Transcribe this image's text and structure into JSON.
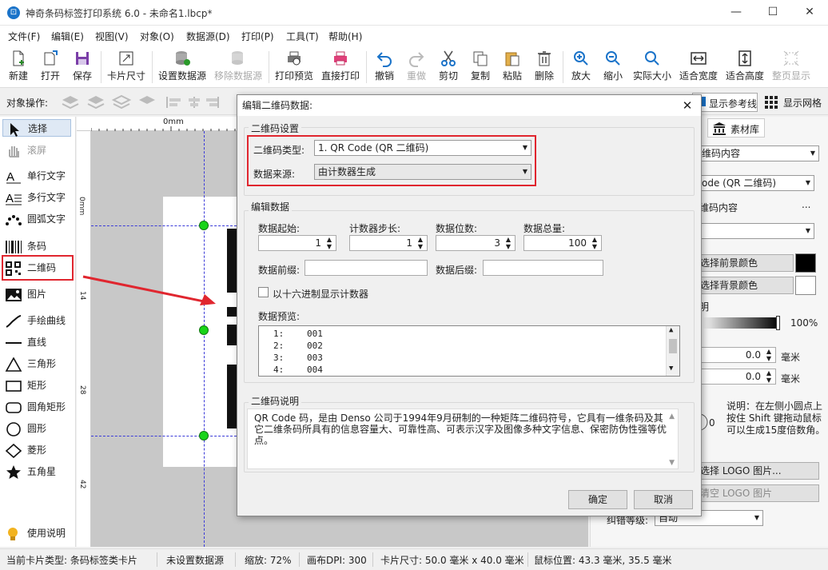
{
  "window": {
    "title": "神奇条码标签打印系统 6.0 - 未命名1.lbcp*",
    "app_icon": "⊡",
    "minimize": "—",
    "maximize": "☐",
    "close": "✕"
  },
  "menu": [
    "文件(F)",
    "编辑(E)",
    "视图(V)",
    "对象(O)",
    "数据源(D)",
    "打印(P)",
    "工具(T)",
    "帮助(H)"
  ],
  "toolbar": [
    {
      "label": "新建",
      "icon": "new-file-icon"
    },
    {
      "label": "打开",
      "icon": "open-icon"
    },
    {
      "label": "保存",
      "icon": "save-icon"
    },
    {
      "label": "卡片尺寸",
      "icon": "card-size-icon"
    },
    {
      "label": "设置数据源",
      "icon": "database-icon"
    },
    {
      "label": "移除数据源",
      "icon": "remove-database-icon"
    },
    {
      "label": "打印预览",
      "icon": "print-preview-icon"
    },
    {
      "label": "直接打印",
      "icon": "print-icon"
    },
    {
      "label": "撤销",
      "icon": "undo-icon"
    },
    {
      "label": "重做",
      "icon": "redo-icon"
    },
    {
      "label": "剪切",
      "icon": "cut-icon"
    },
    {
      "label": "复制",
      "icon": "copy-icon"
    },
    {
      "label": "粘贴",
      "icon": "paste-icon"
    },
    {
      "label": "删除",
      "icon": "delete-icon"
    },
    {
      "label": "放大",
      "icon": "zoom-in-icon"
    },
    {
      "label": "缩小",
      "icon": "zoom-out-icon"
    },
    {
      "label": "实际大小",
      "icon": "actual-size-icon"
    },
    {
      "label": "适合宽度",
      "icon": "fit-width-icon"
    },
    {
      "label": "适合高度",
      "icon": "fit-height-icon"
    },
    {
      "label": "整页显示",
      "icon": "full-page-icon"
    }
  ],
  "objbar": {
    "label": "对象操作:",
    "show_guides": "显示参考线",
    "show_grid": "显示网格"
  },
  "leftpanel": [
    {
      "label": "选择",
      "icon": "pointer-icon"
    },
    {
      "label": "滚屏",
      "icon": "hand-icon"
    },
    {
      "label": "单行文字",
      "icon": "single-line-text-icon"
    },
    {
      "label": "多行文字",
      "icon": "multi-line-text-icon"
    },
    {
      "label": "圆弧文字",
      "icon": "arc-text-icon"
    },
    {
      "label": "条码",
      "icon": "barcode-icon"
    },
    {
      "label": "二维码",
      "icon": "qrcode-icon"
    },
    {
      "label": "图片",
      "icon": "image-icon"
    },
    {
      "label": "手绘曲线",
      "icon": "freehand-icon"
    },
    {
      "label": "直线",
      "icon": "line-icon"
    },
    {
      "label": "三角形",
      "icon": "triangle-icon"
    },
    {
      "label": "矩形",
      "icon": "rectangle-icon"
    },
    {
      "label": "圆角矩形",
      "icon": "rounded-rect-icon"
    },
    {
      "label": "圆形",
      "icon": "circle-icon"
    },
    {
      "label": "菱形",
      "icon": "diamond-icon"
    },
    {
      "label": "五角星",
      "icon": "star-icon"
    },
    {
      "label": "使用说明",
      "icon": "lightbulb-icon"
    }
  ],
  "rulers": {
    "h0": "0mm",
    "v": [
      "0mm",
      "14",
      "28",
      "42"
    ]
  },
  "rightpanel": {
    "tab_material": "素材库",
    "content_combo": "维码内容",
    "type_combo": "ode (QR 二维码)",
    "content_label": "维码内容",
    "more": "...",
    "fg_btn": "选择前景颜色",
    "bg_btn": "选择背景颜色",
    "transparency_label": "明",
    "opacity": "100%",
    "val1": "0.0",
    "val2": "0.0",
    "unit": "毫米",
    "zero": "0",
    "hint": "说明：在左侧小圆点上按住 Shift 键拖动鼠标可以生成15度倍数角。",
    "logo_btn": "选择 LOGO 图片...",
    "clear_logo_btn": "清空 LOGO 图片",
    "ecc_label": "纠错等级:",
    "ecc_value": "自动"
  },
  "dialog": {
    "title": "编辑二维码数据:",
    "qr_settings": "二维码设置",
    "qr_type_label": "二维码类型:",
    "qr_type_value": "1. QR Code (QR 二维码)",
    "source_label": "数据来源:",
    "source_value": "由计数器生成",
    "edit_data": "编辑数据",
    "start_label": "数据起始:",
    "start_value": "1",
    "step_label": "计数器步长:",
    "step_value": "1",
    "digits_label": "数据位数:",
    "digits_value": "3",
    "total_label": "数据总量:",
    "total_value": "100",
    "prefix_label": "数据前缀:",
    "suffix_label": "数据后缀:",
    "hex_label": "以十六进制显示计数器",
    "preview_label": "数据预览:",
    "preview_rows": [
      {
        "n": "1:",
        "v": "001"
      },
      {
        "n": "2:",
        "v": "002"
      },
      {
        "n": "3:",
        "v": "003"
      },
      {
        "n": "4:",
        "v": "004"
      }
    ],
    "desc_title": "二维码说明",
    "desc_text": "QR Code 码，是由 Denso 公司于1994年9月研制的一种矩阵二维码符号，它具有一维条码及其它二维条码所具有的信息容量大、可靠性高、可表示汉字及图像多种文字信息、保密防伪性强等优点。",
    "ok": "确定",
    "cancel": "取消"
  },
  "status": {
    "card_type": "当前卡片类型: 条码标签类卡片",
    "datasource": "未设置数据源",
    "zoom": "缩放: 72%",
    "dpi": "画布DPI: 300",
    "card_size": "卡片尺寸: 50.0 毫米 x 40.0 毫米",
    "mouse": "鼠标位置: 43.3 毫米, 35.5 毫米"
  },
  "colors": {
    "accent": "#e0262f",
    "handle": "#19d419"
  }
}
